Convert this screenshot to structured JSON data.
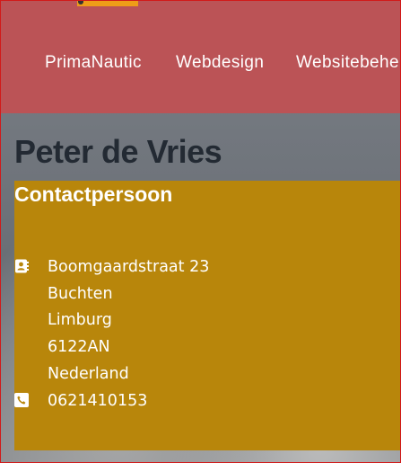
{
  "nav": {
    "items": [
      "PrimaNautic",
      "Webdesign",
      "Websitebehe"
    ]
  },
  "contact": {
    "name": "Peter de Vries",
    "role": "Contactpersoon",
    "address": {
      "street": "Boomgaardstraat 23",
      "city": "Buchten",
      "province": "Limburg",
      "postal_code": "6122AN",
      "country": "Nederland"
    },
    "phone": "0621410153"
  },
  "icons": {
    "address": "address-book-icon",
    "phone": "phone-icon"
  },
  "colors": {
    "navbar": "#bb5356",
    "card": "#b8860b",
    "title": "#232a33",
    "accent": "#ee9d18"
  }
}
